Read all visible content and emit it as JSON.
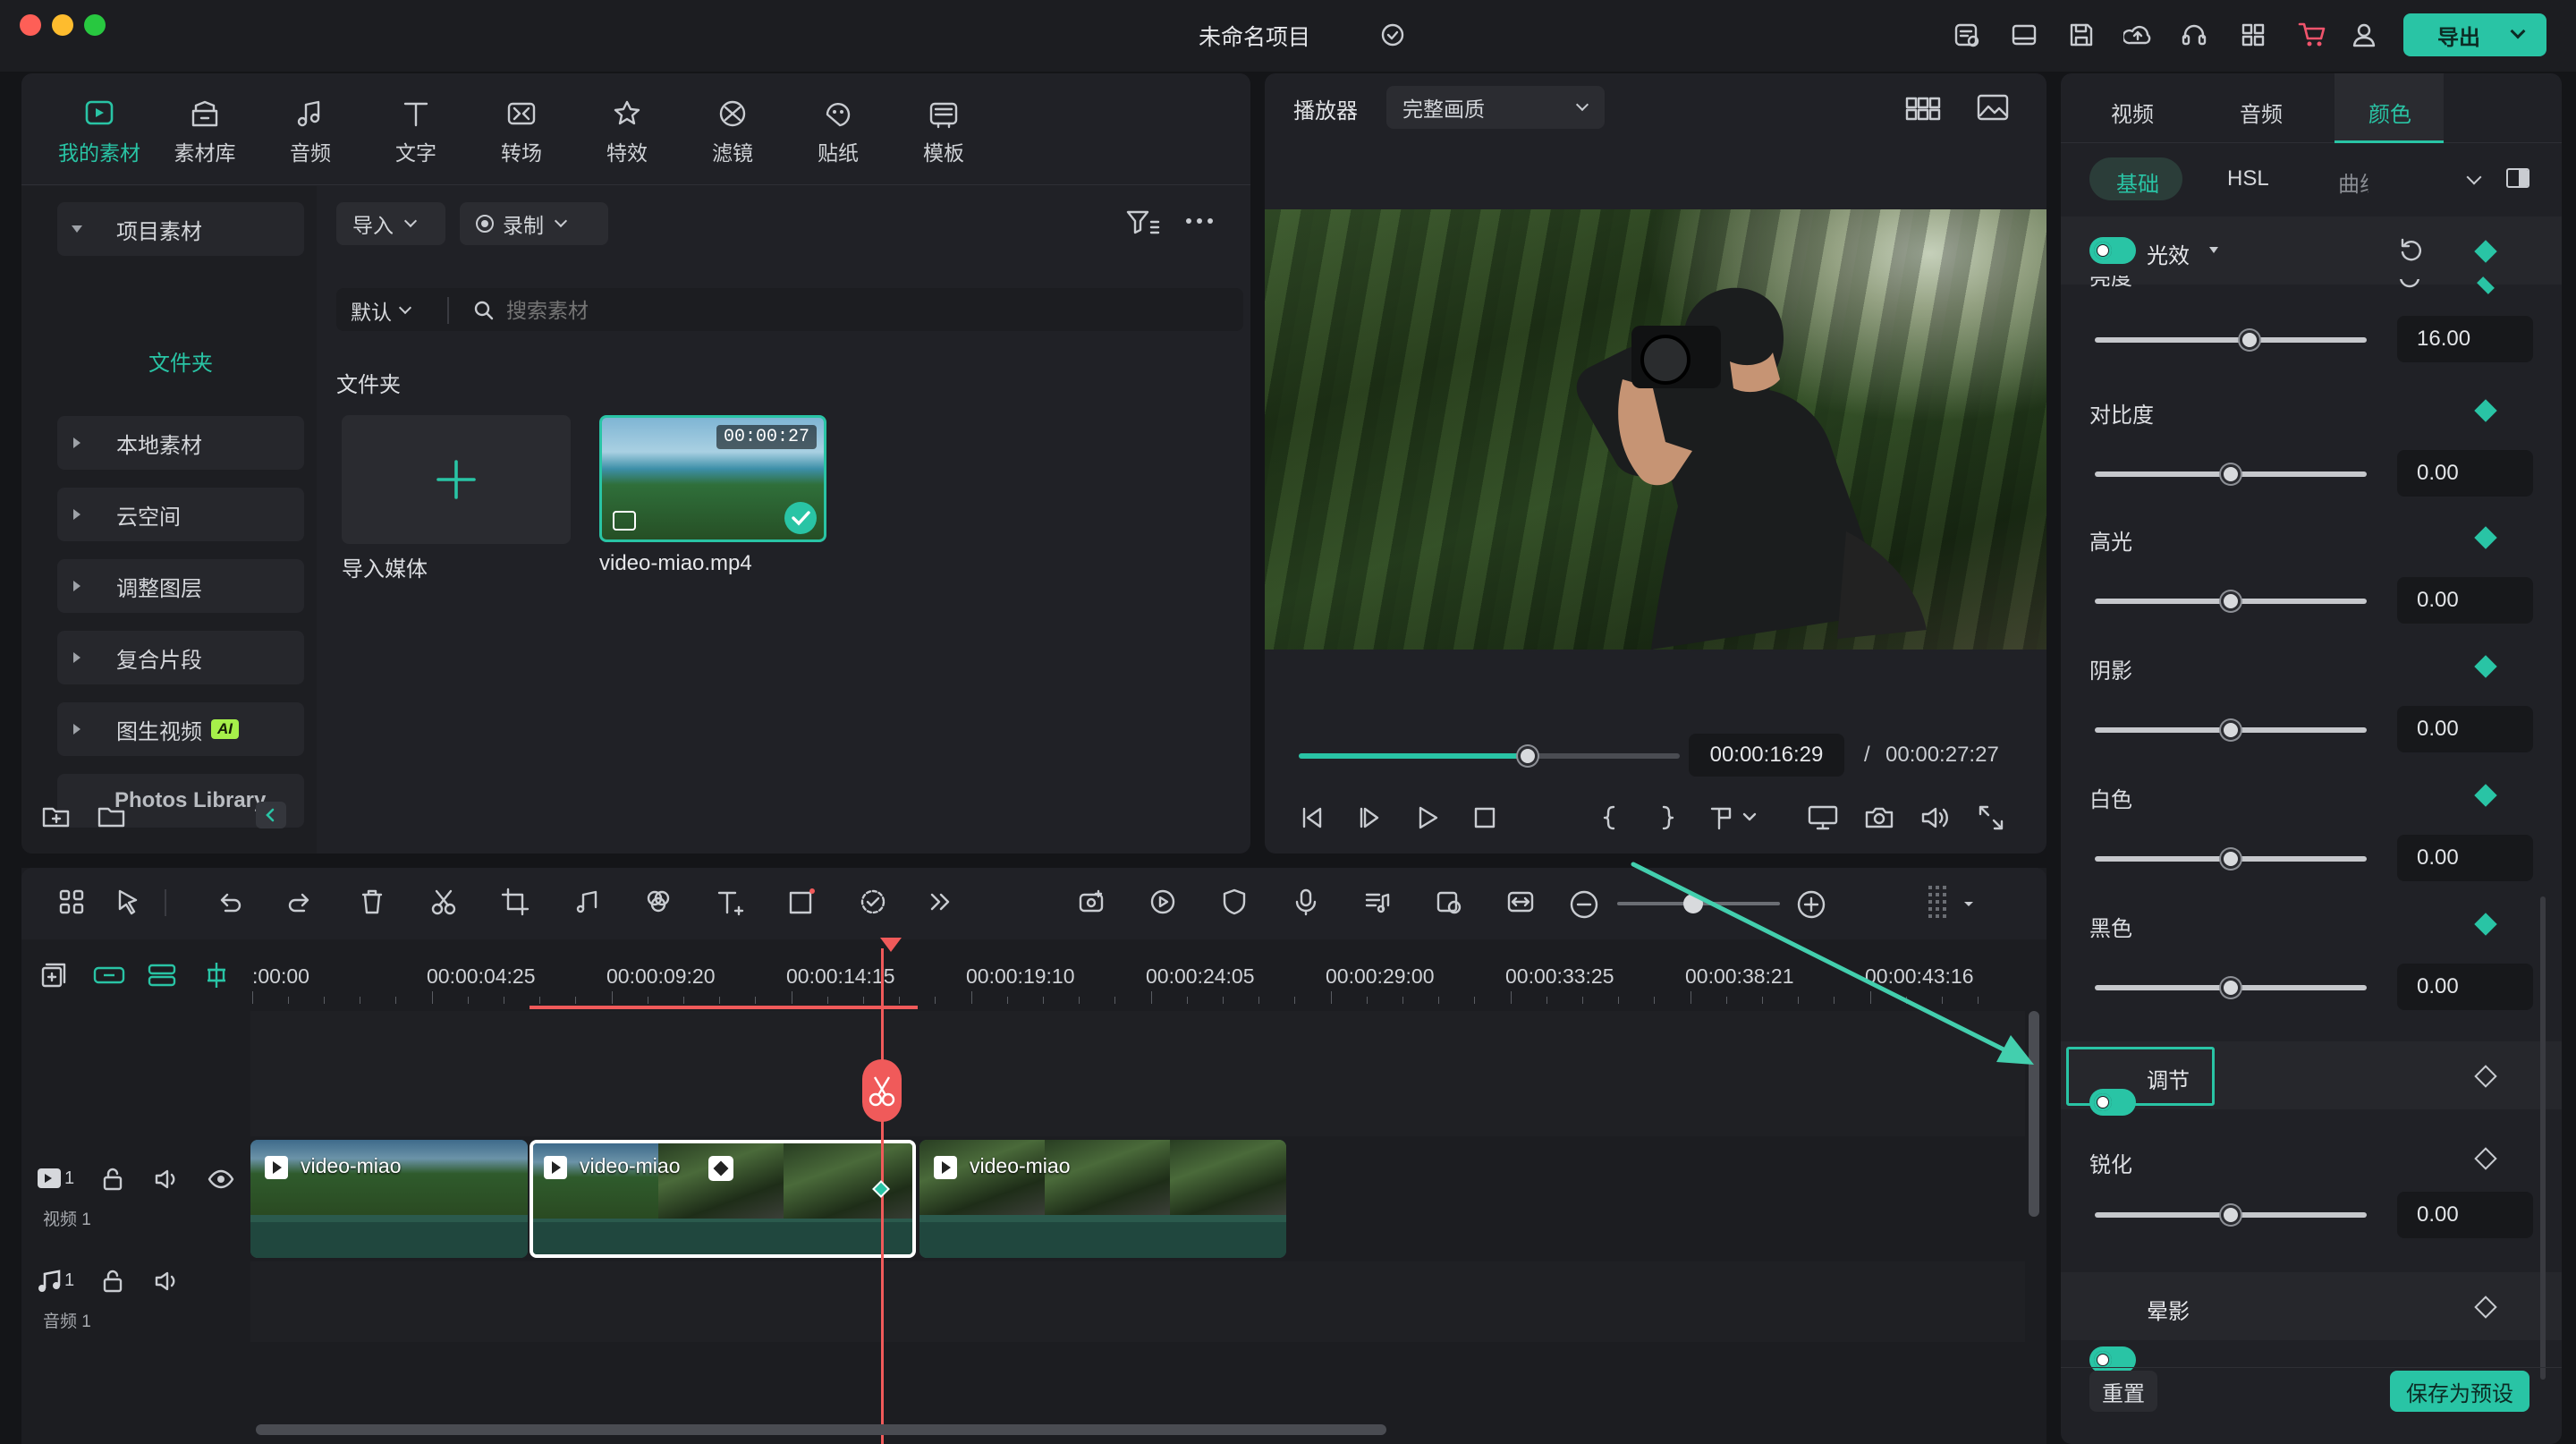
{
  "app": {
    "project_title": "未命名项目",
    "export_label": "导出"
  },
  "colors": {
    "accent": "#29c4a5",
    "playhead": "#f05a5a",
    "panel": "#202126",
    "background": "#141518"
  },
  "media_tabs": [
    {
      "label": "我的素材",
      "icon": "my-media-icon",
      "active": true
    },
    {
      "label": "素材库",
      "icon": "stock-library-icon"
    },
    {
      "label": "音频",
      "icon": "music-note-icon"
    },
    {
      "label": "文字",
      "icon": "text-icon"
    },
    {
      "label": "转场",
      "icon": "transition-icon"
    },
    {
      "label": "特效",
      "icon": "effects-icon"
    },
    {
      "label": "滤镜",
      "icon": "filter-icon"
    },
    {
      "label": "贴纸",
      "icon": "sticker-icon"
    },
    {
      "label": "模板",
      "icon": "template-icon"
    }
  ],
  "sidebar": {
    "project_media": "项目素材",
    "folder": "文件夹",
    "items": [
      "本地素材",
      "云空间",
      "调整图层",
      "复合片段",
      "图生视频"
    ],
    "ai_badge": "AI",
    "photos_library": "Photos Library"
  },
  "media_toolbar": {
    "import": "导入",
    "record": "录制",
    "sort": "默认",
    "search_placeholder": "搜索素材"
  },
  "media_area": {
    "folder_heading": "文件夹",
    "import_tile_label": "导入媒体",
    "clip": {
      "name": "video-miao.mp4",
      "duration": "00:00:27"
    }
  },
  "player": {
    "label": "播放器",
    "quality": "完整画质",
    "current_time": "00:00:16:29",
    "separator": "/",
    "total_time": "00:00:27:27",
    "progress": 0.6
  },
  "right_panel": {
    "tabs": [
      "视频",
      "音频",
      "颜色"
    ],
    "active_tab": "颜色",
    "subtabs": [
      "基础",
      "HSL",
      "曲线"
    ],
    "light_section": "光效",
    "brightness_label": "亮度",
    "properties": [
      {
        "label": "亮度",
        "value": "16.00",
        "level": 0.57
      },
      {
        "label": "对比度",
        "value": "0.00",
        "level": 0.5
      },
      {
        "label": "高光",
        "value": "0.00",
        "level": 0.5
      },
      {
        "label": "阴影",
        "value": "0.00",
        "level": 0.5
      },
      {
        "label": "白色",
        "value": "0.00",
        "level": 0.5
      },
      {
        "label": "黑色",
        "value": "0.00",
        "level": 0.5
      }
    ],
    "adjust_section": "调节",
    "sharpen": {
      "label": "锐化",
      "value": "0.00",
      "level": 0.5
    },
    "vignette_section": "晕影",
    "reset_label": "重置",
    "save_preset_label": "保存为预设"
  },
  "timeline": {
    "ruler_ticks": [
      ":00:00",
      "00:00:04:25",
      "00:00:09:20",
      "00:00:14:15",
      "00:00:19:10",
      "00:00:24:05",
      "00:00:29:00",
      "00:00:33:25",
      "00:00:38:21",
      "00:00:43:16"
    ],
    "clips": [
      "video-miao",
      "video-miao",
      "video-miao"
    ],
    "video_track": {
      "index": "1",
      "name": "视频 1"
    },
    "audio_track": {
      "index": "1",
      "name": "音频 1"
    }
  }
}
